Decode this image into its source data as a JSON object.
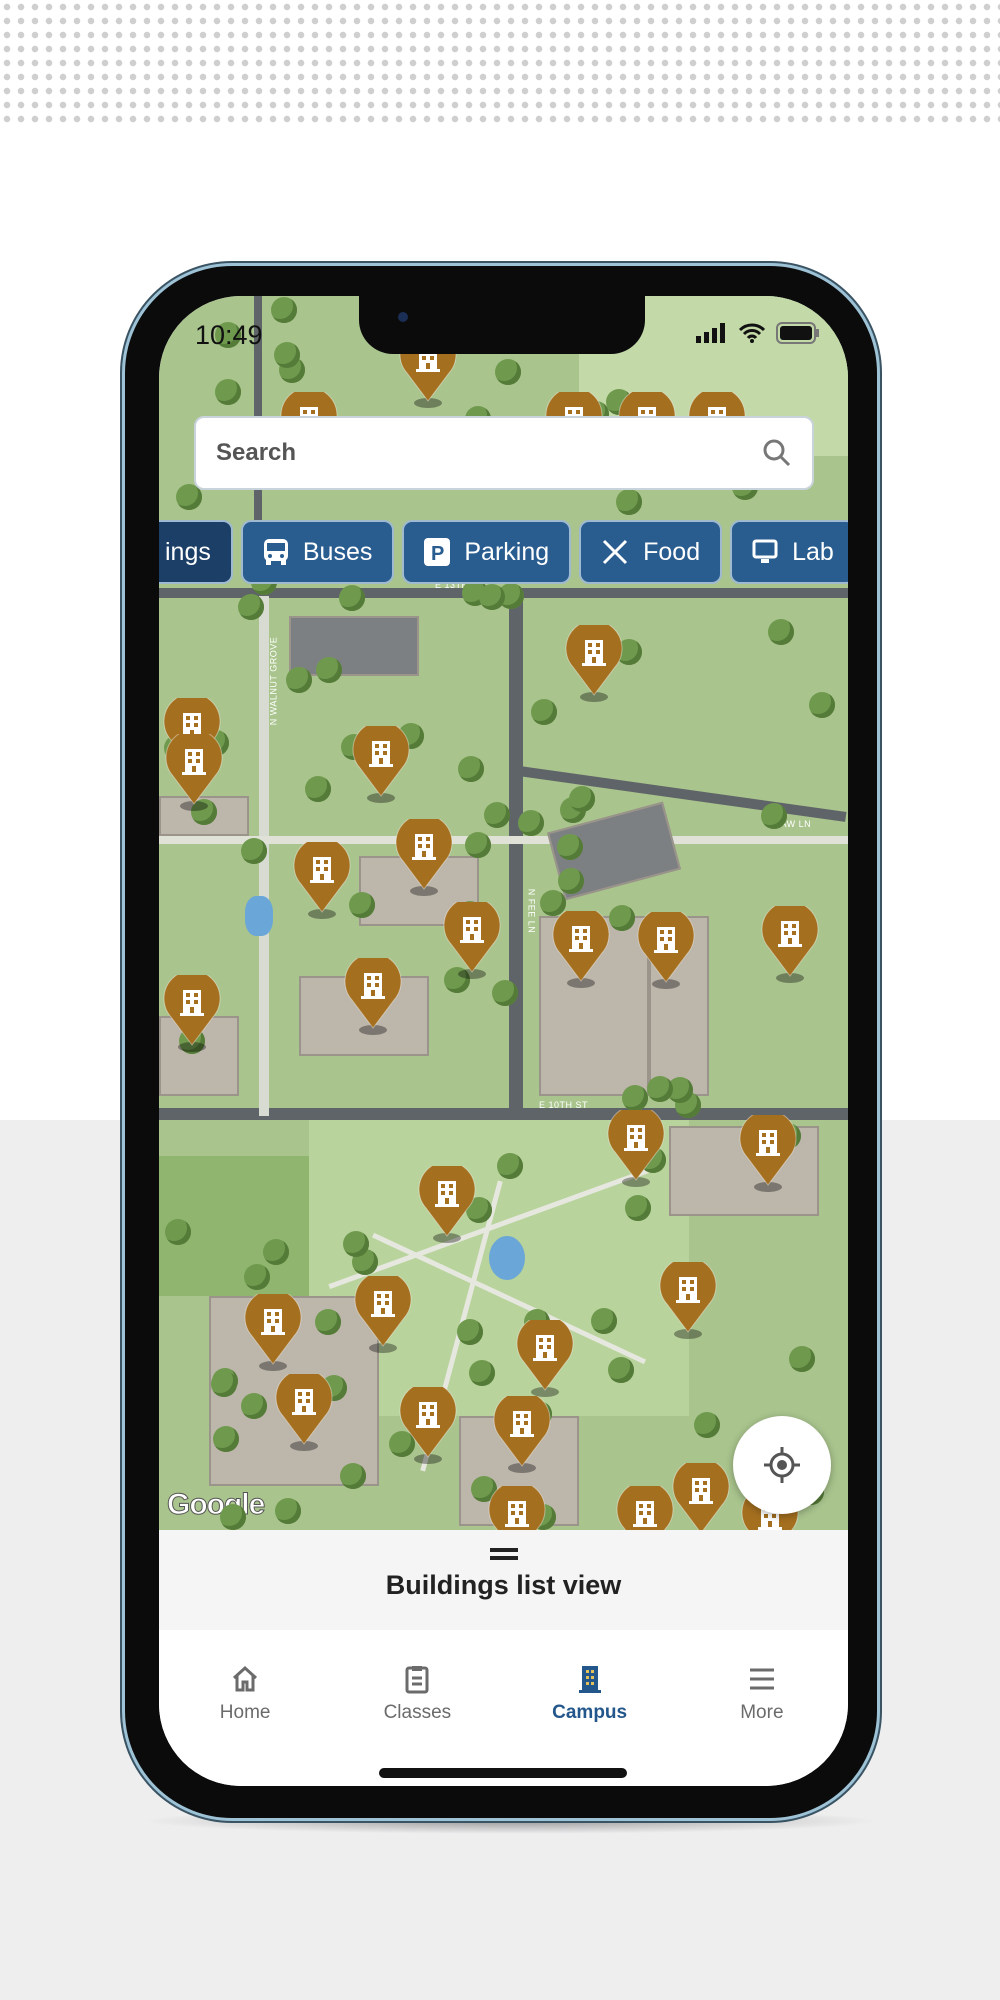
{
  "status_bar": {
    "time": "10:49"
  },
  "search": {
    "placeholder": "Search"
  },
  "chips": [
    {
      "label": "ings",
      "icon": "building-icon",
      "active": true
    },
    {
      "label": "Buses",
      "icon": "bus-icon"
    },
    {
      "label": "Parking",
      "icon": "parking-icon"
    },
    {
      "label": "Food",
      "icon": "utensils-icon"
    },
    {
      "label": "Lab",
      "icon": "monitor-icon"
    }
  ],
  "map": {
    "attribution": "Google",
    "streets": [
      "E 13TH ST",
      "N WALNUT GROVE",
      "N FEE LN",
      "E 10TH ST",
      "LAW LN"
    ],
    "pin_color": "#a46f1f",
    "pin_icon": "building-icon"
  },
  "sheet": {
    "title": "Buildings list view"
  },
  "nav": [
    {
      "label": "Home",
      "icon": "home-icon"
    },
    {
      "label": "Classes",
      "icon": "clipboard-icon"
    },
    {
      "label": "Campus",
      "icon": "building-icon",
      "active": true
    },
    {
      "label": "More",
      "icon": "menu-icon"
    }
  ],
  "colors": {
    "accent": "#23578b",
    "chip": "#2a5d8f",
    "pin": "#a46f1f"
  }
}
